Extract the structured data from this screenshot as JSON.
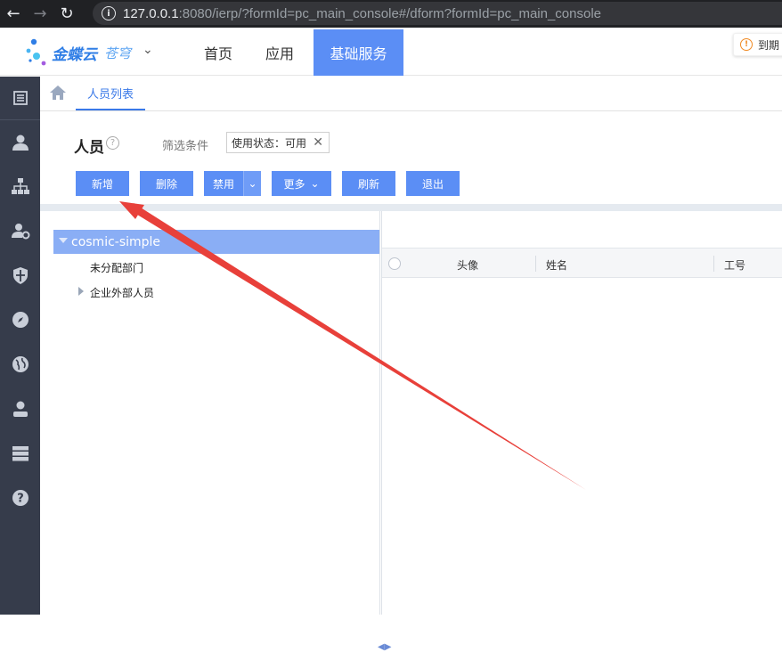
{
  "browser": {
    "url_host": "127.0.0.1",
    "url_rest": ":8080/ierp/?formId=pc_main_console#/dform?formId=pc_main_console"
  },
  "header": {
    "brand": "金蝶云",
    "brand_sub": "苍穹",
    "nav": [
      "首页",
      "应用",
      "基础服务"
    ],
    "notice_text": "到期"
  },
  "tabs": {
    "active_label": "人员列表"
  },
  "page": {
    "title": "人员",
    "filter_label": "筛选条件",
    "filter_chip": "使用状态：可用"
  },
  "toolbar": {
    "new_label": "新增",
    "delete_label": "删除",
    "disable_label": "禁用",
    "more_label": "更多",
    "refresh_label": "刷新",
    "exit_label": "退出"
  },
  "tree": {
    "root_label": "cosmic-simple",
    "items": [
      "未分配部门",
      "企业外部人员"
    ]
  },
  "grid": {
    "columns": [
      "头像",
      "姓名",
      "工号"
    ]
  },
  "colors": {
    "accent": "#5b8ef5",
    "sidebar": "#363c4b",
    "annotation_arrow": "#e8403a"
  }
}
